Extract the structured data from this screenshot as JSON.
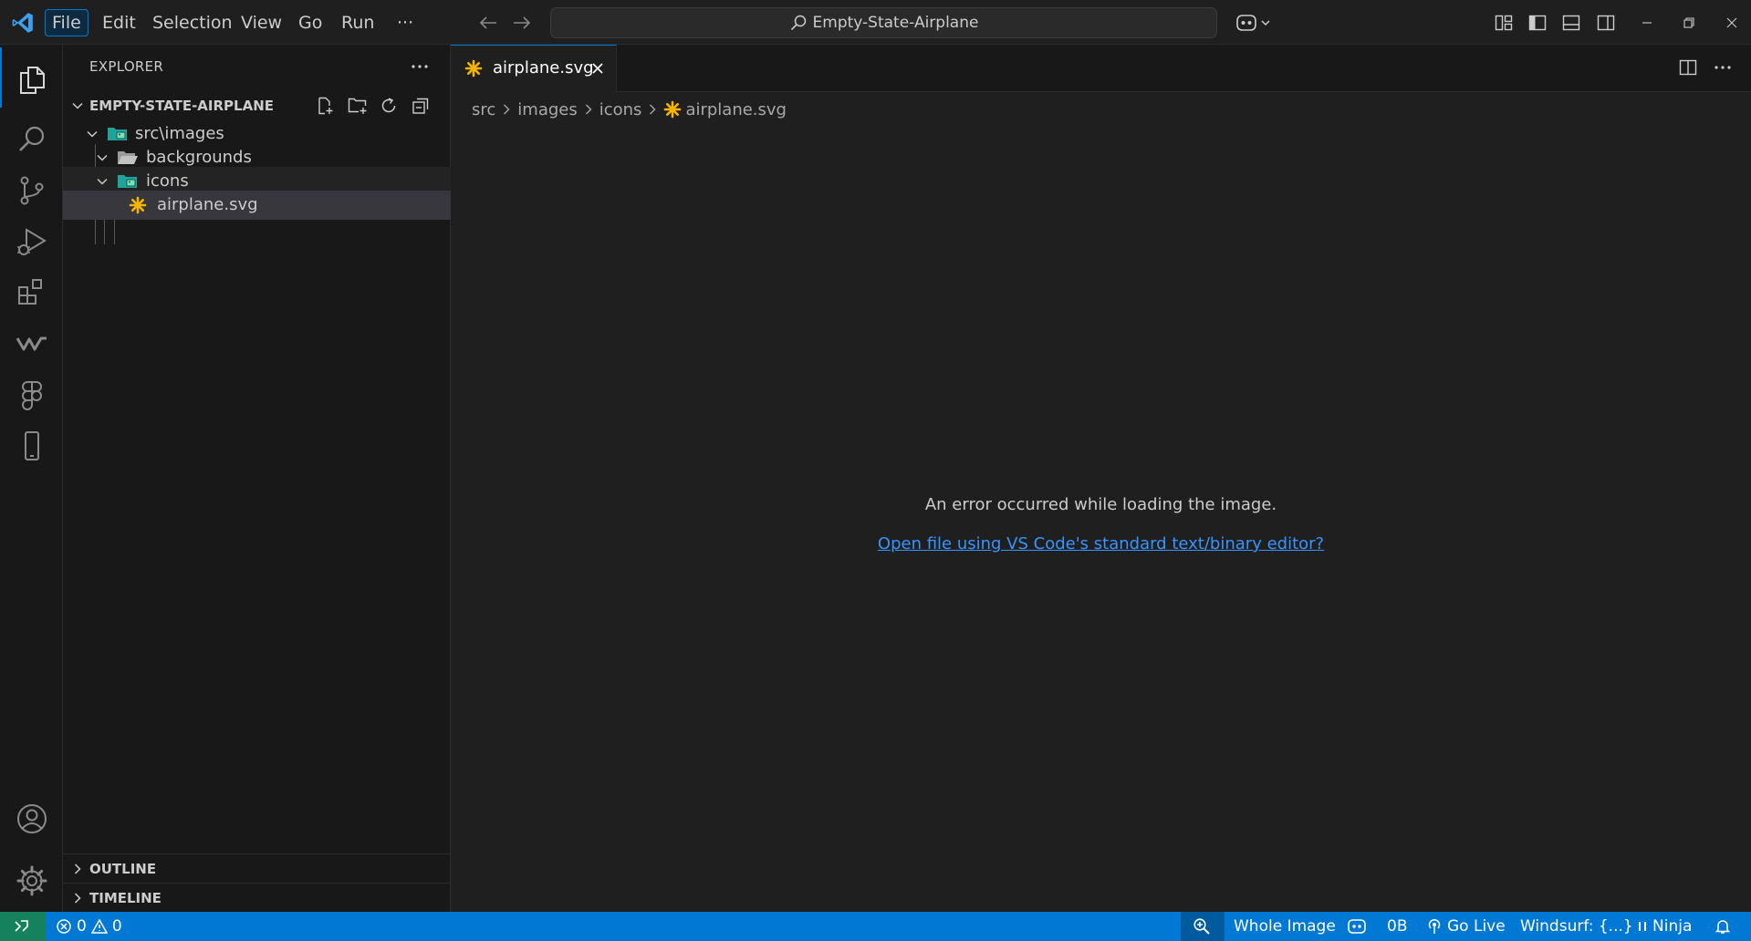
{
  "menu": {
    "items": [
      "File",
      "Edit",
      "Selection",
      "View",
      "Go",
      "Run",
      "···"
    ]
  },
  "command_center": {
    "text": "Empty-State-Airplane"
  },
  "explorer": {
    "title": "EXPLORER",
    "folder_name": "EMPTY-STATE-AIRPLANE",
    "tree": [
      {
        "label": "src\\images",
        "type": "folder-images",
        "expanded": true
      },
      {
        "label": "backgrounds",
        "type": "folder",
        "expanded": true
      },
      {
        "label": "icons",
        "type": "folder-images",
        "expanded": true
      },
      {
        "label": "airplane.svg",
        "type": "svg-file"
      }
    ],
    "panels": [
      "OUTLINE",
      "TIMELINE"
    ]
  },
  "editor": {
    "tab_label": "airplane.svg",
    "breadcrumb": [
      "src",
      "images",
      "icons",
      "airplane.svg"
    ],
    "error_message": "An error occurred while loading the image.",
    "open_link": "Open file using VS Code's standard text/binary editor?"
  },
  "statusbar": {
    "errors": "0",
    "warnings": "0",
    "zoom_label": "Whole Image",
    "size": "0B",
    "go_live": "Go Live",
    "windsurf": "Windsurf: {...}",
    "ninja": "Ninja"
  },
  "colors": {
    "accent": "#0078d4",
    "statusbar": "#0078d4",
    "remote": "#16825d",
    "svg_icon": "#f5b400",
    "link": "#3794ff"
  },
  "icons": {
    "activity": [
      "files-icon",
      "search-icon",
      "source-control-icon",
      "run-debug-icon",
      "extensions-icon",
      "windsurf-icon",
      "figma-icon",
      "mobile-icon",
      "account-icon",
      "settings-gear-icon"
    ]
  }
}
